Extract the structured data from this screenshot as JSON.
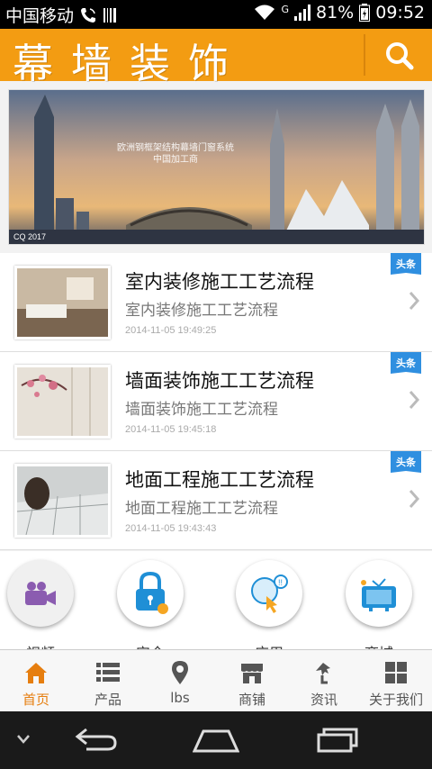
{
  "status_bar": {
    "carrier": "中国移动",
    "network": "G",
    "battery": "81%",
    "time": "09:52"
  },
  "app_bar": {
    "title": "幕墙装饰",
    "search_icon": "search-icon"
  },
  "banner": {
    "caption_line1": "欧洲钢框架结构幕墙门窗系统",
    "caption_line2": "中国加工商"
  },
  "news": {
    "badge": "头条",
    "items": [
      {
        "title": "室内装修施工工艺流程",
        "subtitle": "室内装修施工工艺流程",
        "time": "2014-11-05 19:49:25"
      },
      {
        "title": "墙面装饰施工工艺流程",
        "subtitle": "墙面装饰施工工艺流程",
        "time": "2014-11-05 19:45:18"
      },
      {
        "title": "地面工程施工工艺流程",
        "subtitle": "地面工程施工工艺流程",
        "time": "2014-11-05 19:43:43"
      }
    ]
  },
  "quick_links": {
    "items": [
      {
        "icon": "video-camera-icon",
        "label": "视频"
      },
      {
        "icon": "lock-icon",
        "label": "安全"
      },
      {
        "icon": "mouse-icon",
        "label": "应用"
      },
      {
        "icon": "tv-icon",
        "label": "商城"
      }
    ]
  },
  "tab_bar": {
    "accent": "#e67e0f",
    "items": [
      {
        "icon": "home-icon",
        "label": "首页"
      },
      {
        "icon": "list-icon",
        "label": "产品"
      },
      {
        "icon": "location-pin-icon",
        "label": "lbs"
      },
      {
        "icon": "store-icon",
        "label": "商铺"
      },
      {
        "icon": "news-icon",
        "label": "资讯"
      },
      {
        "icon": "grid-icon",
        "label": "关于我们"
      }
    ]
  },
  "colors": {
    "header": "#f39c12",
    "badge": "#2f8fe0"
  }
}
